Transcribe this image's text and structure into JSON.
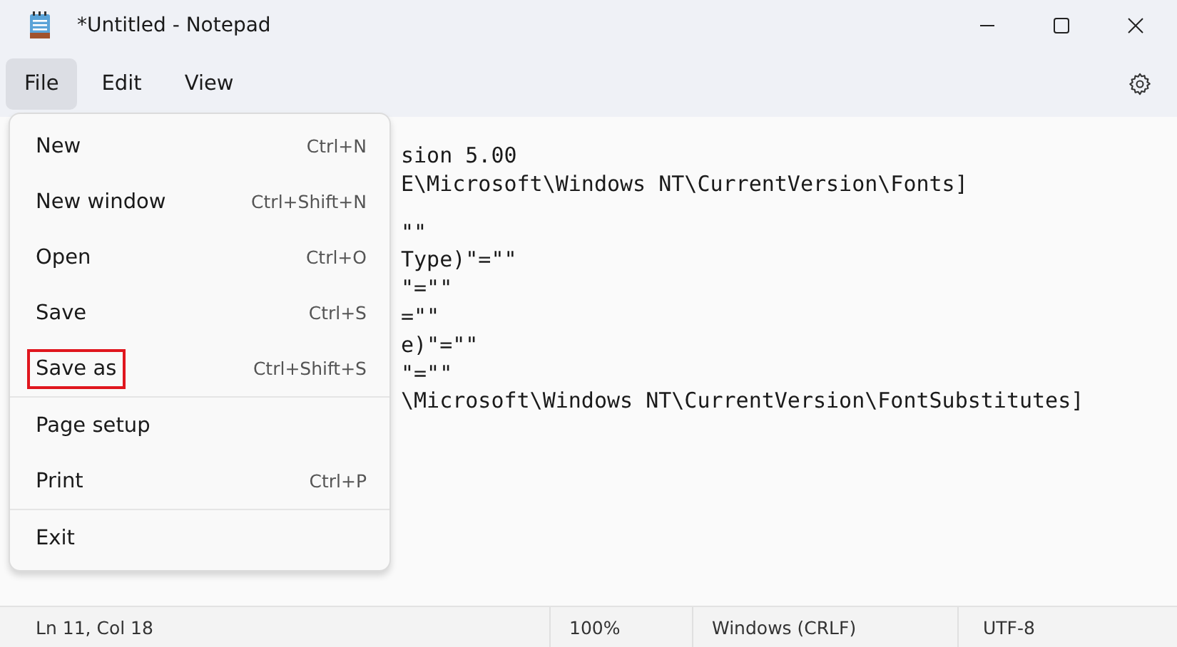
{
  "window": {
    "title": "*Untitled - Notepad"
  },
  "menubar": [
    {
      "label": "File",
      "selected": true
    },
    {
      "label": "Edit",
      "selected": false
    },
    {
      "label": "View",
      "selected": false
    }
  ],
  "editor_paragraphs": [
    [
      "sion 5.00",
      "E\\Microsoft\\Windows NT\\CurrentVersion\\Fonts]"
    ],
    [
      "\"\"",
      "Type)\"=\"\"",
      "\"=\"\"",
      "=\"\"",
      "e)\"=\"\"",
      "\"=\"\"",
      "\\Microsoft\\Windows NT\\CurrentVersion\\FontSubstitutes]"
    ]
  ],
  "file_menu_groups": [
    [
      {
        "label": "New",
        "shortcut": "Ctrl+N",
        "outlined": false
      },
      {
        "label": "New window",
        "shortcut": "Ctrl+Shift+N",
        "outlined": false
      },
      {
        "label": "Open",
        "shortcut": "Ctrl+O",
        "outlined": false
      },
      {
        "label": "Save",
        "shortcut": "Ctrl+S",
        "outlined": false
      },
      {
        "label": "Save as",
        "shortcut": "Ctrl+Shift+S",
        "outlined": true
      }
    ],
    [
      {
        "label": "Page setup",
        "outlined": false
      },
      {
        "label": "Print",
        "shortcut": "Ctrl+P",
        "outlined": false
      }
    ],
    [
      {
        "label": "Exit",
        "outlined": false
      }
    ]
  ],
  "status_bar": {
    "position": "Ln 11, Col 18",
    "zoom": "100%",
    "line_ending": "Windows (CRLF)",
    "encoding": "UTF-8"
  }
}
